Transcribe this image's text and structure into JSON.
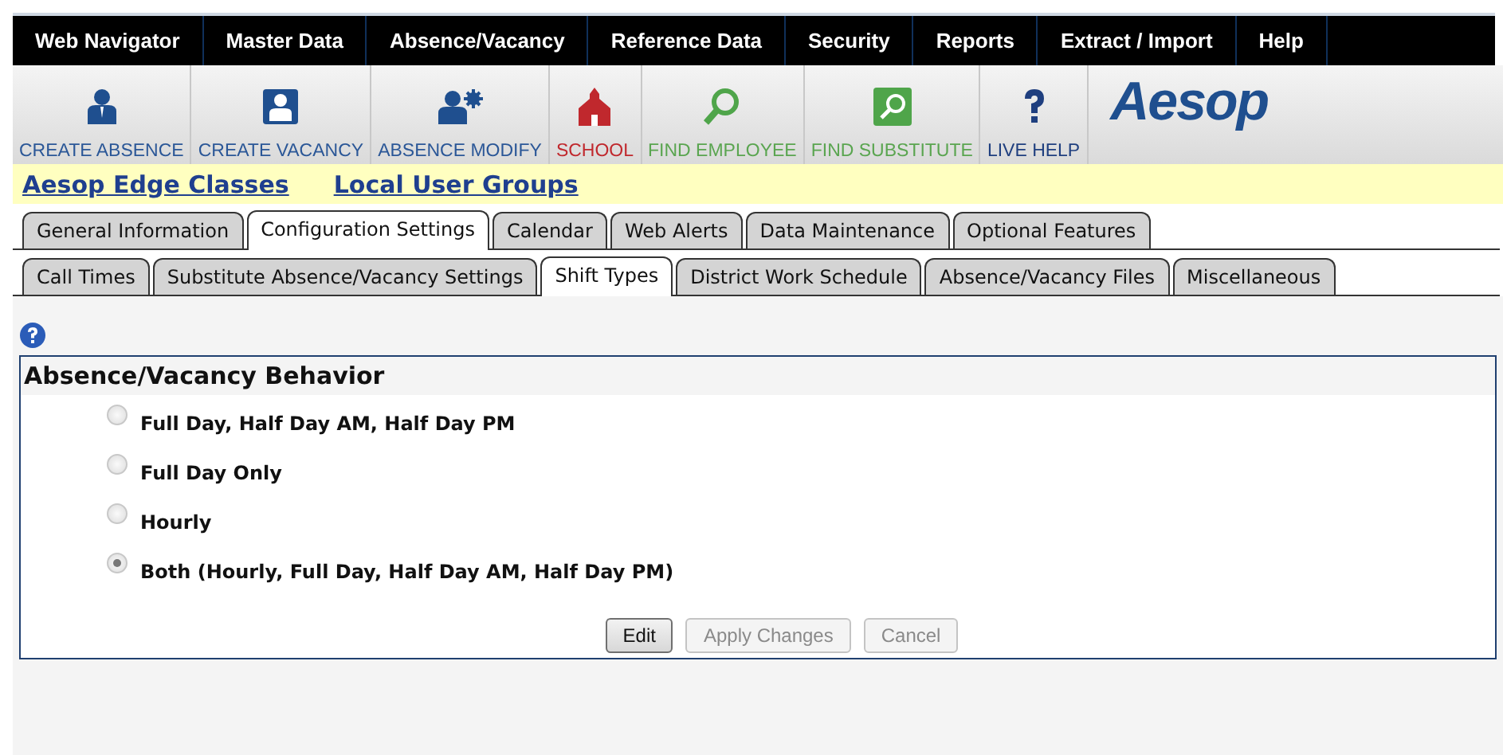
{
  "nav_menu": [
    "Web Navigator",
    "Master Data",
    "Absence/Vacancy",
    "Reference Data",
    "Security",
    "Reports",
    "Extract / Import",
    "Help"
  ],
  "toolbar": [
    {
      "label": "CREATE ABSENCE",
      "color": "#2b5797"
    },
    {
      "label": "CREATE VACANCY",
      "color": "#2b5797"
    },
    {
      "label": "ABSENCE MODIFY",
      "color": "#2b5797"
    },
    {
      "label": "SCHOOL",
      "color": "#c0282d"
    },
    {
      "label": "FIND EMPLOYEE",
      "color": "#5aa550"
    },
    {
      "label": "FIND SUBSTITUTE",
      "color": "#5aa550"
    },
    {
      "label": "LIVE HELP",
      "color": "#1f3f7f"
    }
  ],
  "logo": "Aesop",
  "links": [
    "Aesop Edge Classes",
    "Local User Groups"
  ],
  "tabs": [
    {
      "label": "General Information",
      "selected": false
    },
    {
      "label": "Configuration Settings",
      "selected": true
    },
    {
      "label": "Calendar",
      "selected": false
    },
    {
      "label": "Web Alerts",
      "selected": false
    },
    {
      "label": "Data Maintenance",
      "selected": false
    },
    {
      "label": "Optional Features",
      "selected": false
    }
  ],
  "subtabs": [
    {
      "label": "Call Times",
      "selected": false
    },
    {
      "label": "Substitute Absence/Vacancy Settings",
      "selected": false
    },
    {
      "label": "Shift Types",
      "selected": true
    },
    {
      "label": "District Work Schedule",
      "selected": false
    },
    {
      "label": "Absence/Vacancy Files",
      "selected": false
    },
    {
      "label": "Miscellaneous",
      "selected": false
    }
  ],
  "panel": {
    "title": "Absence/Vacancy Behavior",
    "options": [
      {
        "label": "Full Day, Half Day AM, Half Day PM",
        "selected": false,
        "disabled": true
      },
      {
        "label": "Full Day Only",
        "selected": false,
        "disabled": true
      },
      {
        "label": "Hourly",
        "selected": false,
        "disabled": true
      },
      {
        "label": "Both (Hourly, Full Day, Half Day AM, Half Day PM)",
        "selected": true,
        "disabled": true
      }
    ],
    "buttons": [
      {
        "label": "Edit",
        "disabled": false
      },
      {
        "label": "Apply Changes",
        "disabled": true
      },
      {
        "label": "Cancel",
        "disabled": true
      }
    ]
  }
}
